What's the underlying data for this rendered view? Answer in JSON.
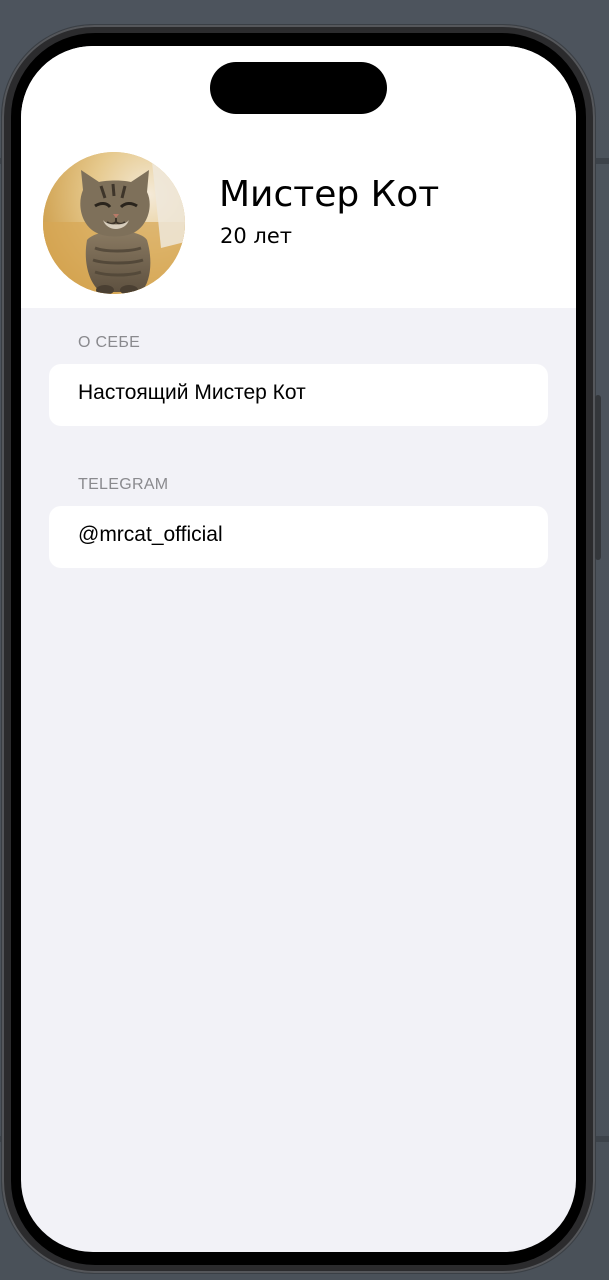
{
  "profile": {
    "name": "Мистер Кот",
    "age": "20 лет",
    "avatar_icon": "cat-photo"
  },
  "sections": [
    {
      "header": "О СЕБЕ",
      "value": "Настоящий Мистер Кот"
    },
    {
      "header": "TELEGRAM",
      "value": "@mrcat_official"
    }
  ],
  "colors": {
    "background": "#f2f2f7",
    "card": "#ffffff",
    "section_header": "#8a8a8e",
    "text": "#000000"
  }
}
